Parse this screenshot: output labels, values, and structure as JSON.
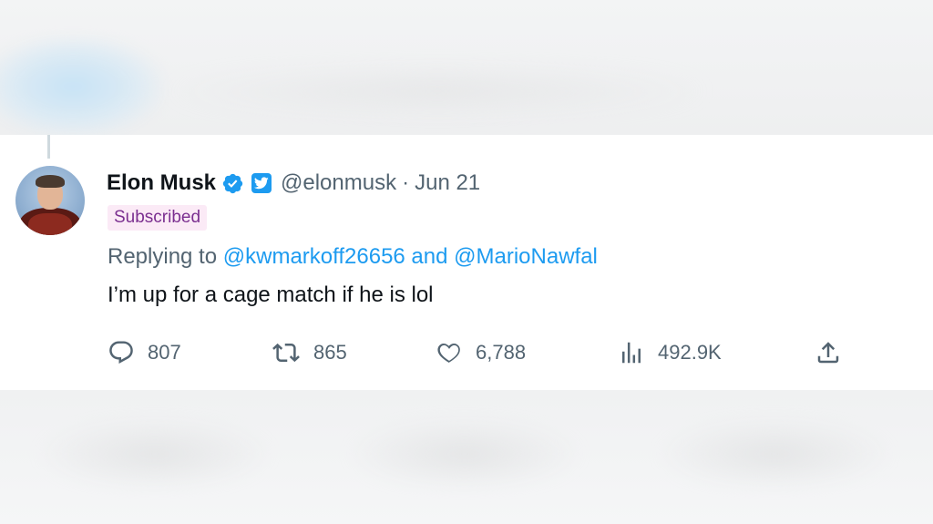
{
  "tweet": {
    "author": {
      "name": "Elon Musk",
      "handle": "@elonmusk",
      "date": "Jun 21",
      "badge": "Subscribed",
      "verified_icon": "verified-badge-icon",
      "affiliation_icon": "twitter-affiliation-icon"
    },
    "reply": {
      "prefix": "Replying to ",
      "user1": "@kwmarkoff26656",
      "joiner": " and ",
      "user2": "@MarioNawfal"
    },
    "text": "I’m up for a cage match if he is lol",
    "actions": {
      "replies": "807",
      "retweets": "865",
      "likes": "6,788",
      "views": "492.9K"
    }
  },
  "colors": {
    "accent": "#1d9bf0",
    "text": "#0f1419",
    "muted": "#536471",
    "badge_bg": "#fbeaf6",
    "badge_text": "#7b2f90"
  }
}
